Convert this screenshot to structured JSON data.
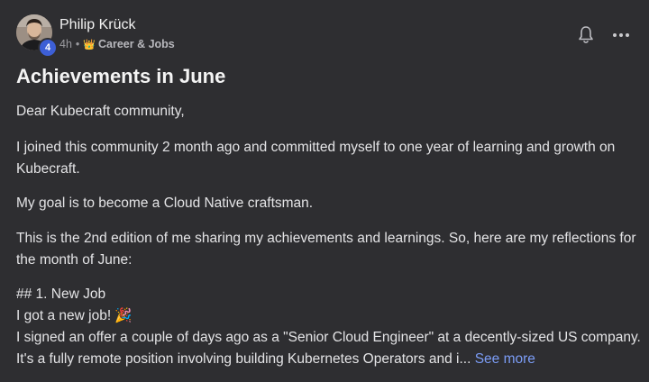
{
  "post": {
    "author": "Philip Krück",
    "level": "4",
    "time": "4h",
    "separator": "•",
    "category_icon": "crown-icon",
    "category_emoji": "👑",
    "category": "Career & Jobs",
    "title": "Achievements in June",
    "paragraphs": {
      "greeting": "Dear Kubecraft community,",
      "intro": "I joined this community 2 month ago and committed myself to one year of learning and growth on Kubecraft.",
      "goal": "My goal is to become a Cloud Native craftsman.",
      "edition": "This is the 2nd edition of me sharing my achievements and learnings. So, here are my reflections for the month of June:",
      "section_heading": "## 1. New Job",
      "new_job": "I got a new job! 🎉",
      "offer_line1": "I signed an offer a couple of days ago as a \"Senior Cloud Engineer\" at a decently-sized US company.",
      "offer_line2": "It's a fully remote position involving building Kubernetes Operators and i..."
    },
    "see_more": "See more"
  },
  "icons": {
    "bell": "bell-icon",
    "more": "more-options-icon"
  },
  "colors": {
    "background": "#2e2e31",
    "text": "#e4e4e6",
    "muted": "#9a9a9f",
    "link": "#7b9cf5",
    "badge": "#3d5fd6"
  }
}
